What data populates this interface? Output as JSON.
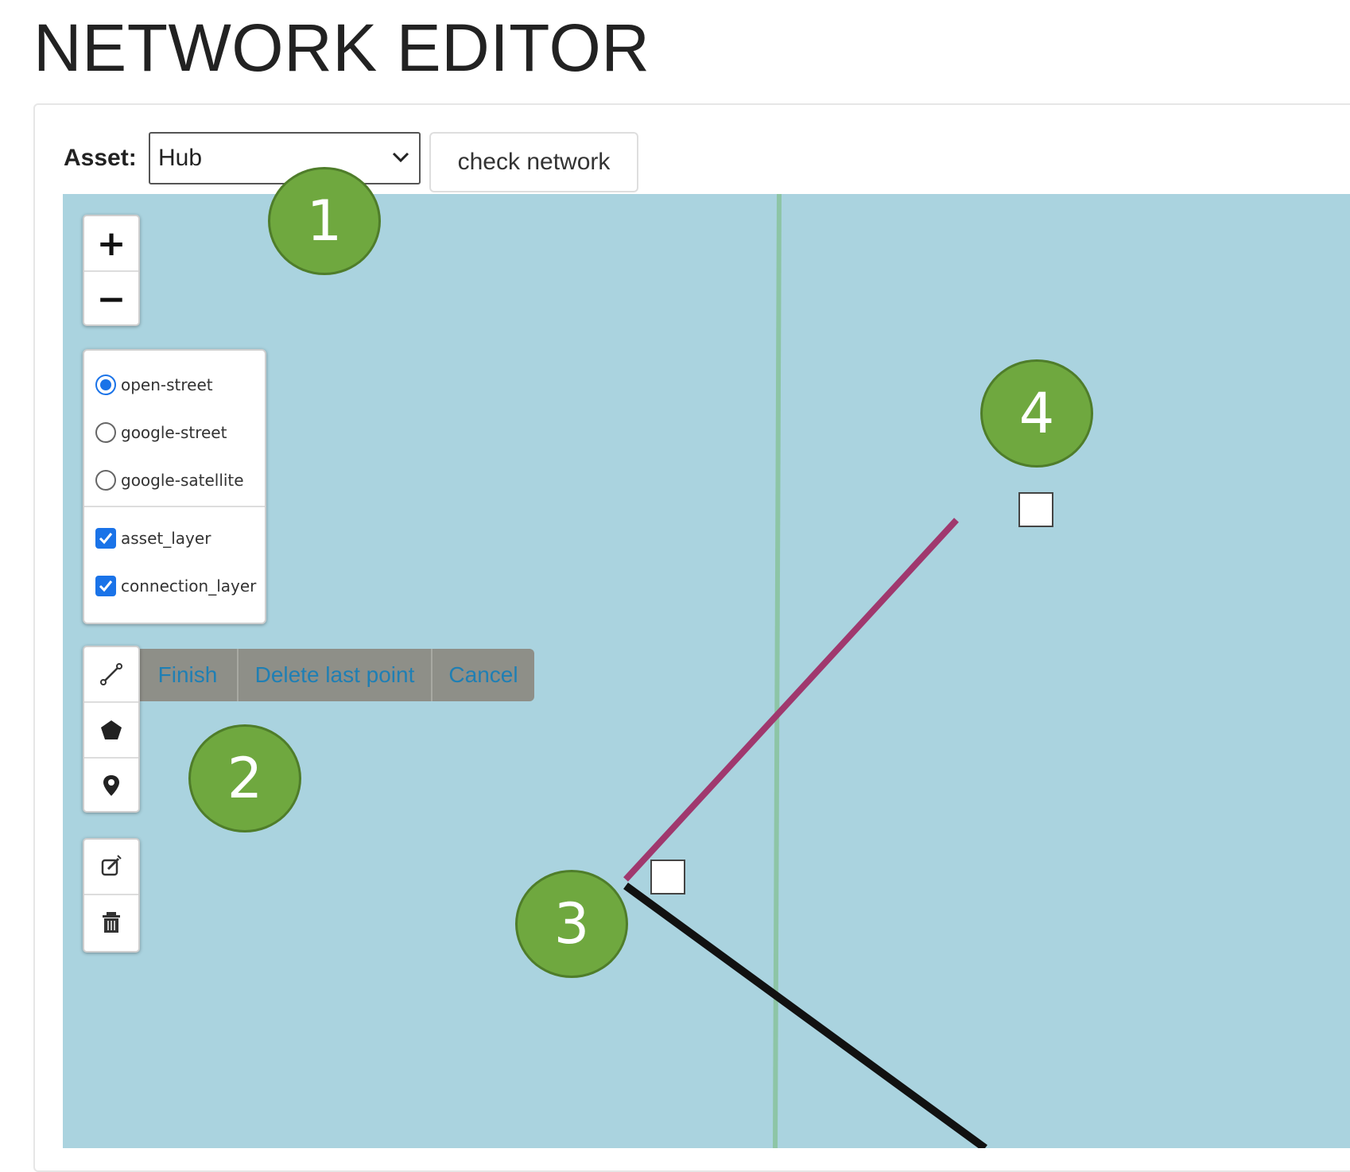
{
  "page": {
    "title": "NETWORK EDITOR"
  },
  "toolbar": {
    "asset_label": "Asset:",
    "asset_select_value": "Hub",
    "check_button_label": "check network"
  },
  "map_controls": {
    "zoom_in_label": "+",
    "zoom_out_label": "−"
  },
  "layer_switcher": {
    "base_layers": [
      {
        "label": "open-street",
        "selected": true
      },
      {
        "label": "google-street",
        "selected": false
      },
      {
        "label": "google-satellite",
        "selected": false
      }
    ],
    "overlays": [
      {
        "label": "asset_layer",
        "checked": true
      },
      {
        "label": "connection_layer",
        "checked": true
      }
    ]
  },
  "draw_toolbar": {
    "tools": [
      "draw-line-icon",
      "draw-polygon-icon",
      "draw-marker-icon"
    ],
    "actions": [
      "Finish",
      "Delete last point",
      "Cancel"
    ]
  },
  "edit_toolbar": {
    "tools": [
      "edit-layers-icon",
      "delete-layers-icon"
    ]
  },
  "annotations": [
    "1",
    "2",
    "3",
    "4"
  ],
  "colors": {
    "map_water": "#aad3df",
    "connection_active": "#a0386e",
    "connection_existing": "#111111",
    "badge_fill": "#6fa83f",
    "action_bar": "#8e8f88",
    "action_text": "#1f7fb4"
  }
}
